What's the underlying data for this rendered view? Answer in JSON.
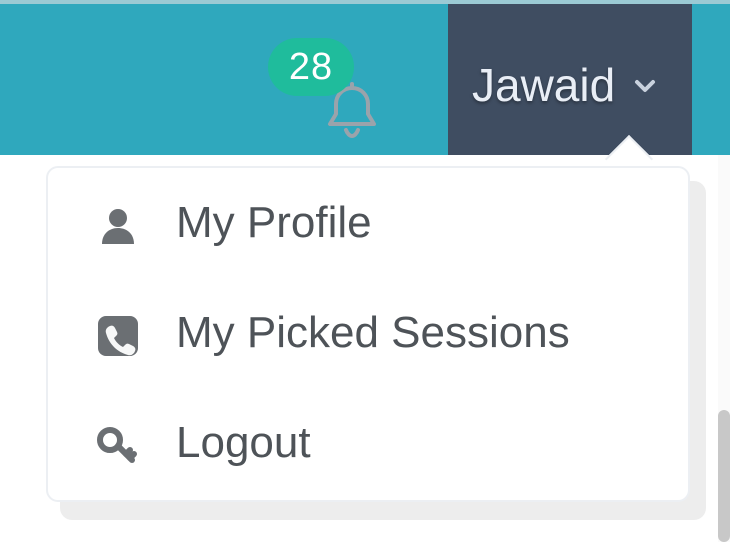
{
  "header": {
    "notification_count": "28",
    "user_name": "Jawaid"
  },
  "menu": {
    "items": [
      {
        "label": "My Profile",
        "icon": "user-icon"
      },
      {
        "label": "My Picked Sessions",
        "icon": "phone-icon"
      },
      {
        "label": "Logout",
        "icon": "key-icon"
      }
    ]
  },
  "colors": {
    "topbar": "#2fa8bd",
    "user_trigger": "#3f4d61",
    "badge": "#1fbc9c",
    "menu_text": "#4e5358",
    "icon": "#6b6f73"
  }
}
